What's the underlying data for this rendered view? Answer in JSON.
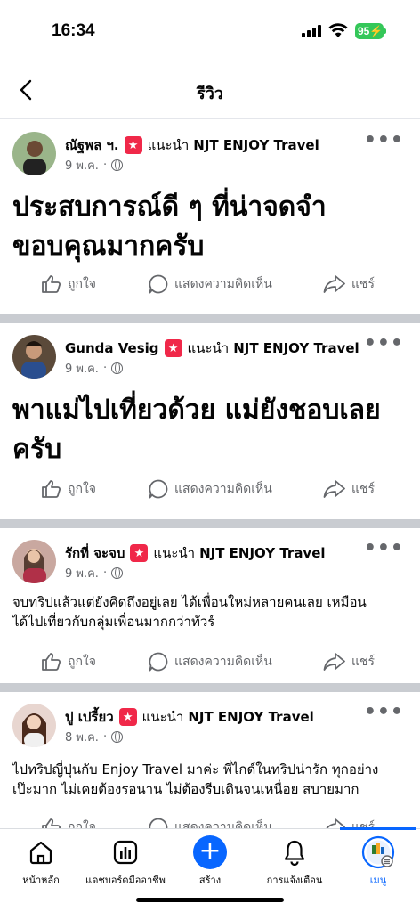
{
  "status": {
    "time": "16:34",
    "battery": "95"
  },
  "header": {
    "title": "รีวิว"
  },
  "posts": [
    {
      "author": "ณัฐพล ฯ.",
      "recommends": "แนะนำ",
      "page": "NJT ENJOY Travel",
      "date": "9 พ.ค.",
      "text_lines": [
        "ประสบการณ์ดี ๆ ที่น่าจดจำ",
        "ขอบคุณมากครับ"
      ],
      "style": "big"
    },
    {
      "author": "Gunda Vesig",
      "recommends": "แนะนำ",
      "page": "NJT ENJOY Travel",
      "date": "9 พ.ค.",
      "text_lines": [
        "พาแม่ไปเที่ยวด้วย แม่ยังชอบเลย",
        "ครับ"
      ],
      "style": "big"
    },
    {
      "author": "รักที่ จะจบ",
      "recommends": "แนะนำ",
      "page": "NJT ENJOY Travel",
      "date": "9 พ.ค.",
      "text_lines": [
        "จบทริปแล้วแต่ยังคิดถึงอยู่เลย ได้เพื่อนใหม่หลายคนเลย เหมือน",
        "ได้ไปเที่ยวกับกลุ่มเพื่อนมากกว่าทัวร์"
      ],
      "style": "small"
    },
    {
      "author": "ปู เปรี้ยว",
      "recommends": "แนะนำ",
      "page": "NJT ENJOY Travel",
      "date": "8 พ.ค.",
      "text_lines": [
        "ไปทริปญี่ปุ่นกับ Enjoy Travel มาค่ะ พี่ไกด์ในทริปน่ารัก ทุกอย่าง",
        "เป๊ะมาก ไม่เคยต้องรอนาน ไม่ต้องรีบเดินจนเหนื่อย สบายมาก"
      ],
      "style": "small"
    }
  ],
  "actions": {
    "like": "ถูกใจ",
    "comment": "แสดงความคิดเห็น",
    "share": "แชร์"
  },
  "nav": {
    "home": "หน้าหลัก",
    "dashboard": "แดชบอร์ดมืออาชีพ",
    "create": "สร้าง",
    "notifications": "การแจ้งเตือน",
    "menu": "เมนู"
  },
  "colors": {
    "accent": "#0866ff",
    "star": "#f02849",
    "battery": "#34c759"
  }
}
